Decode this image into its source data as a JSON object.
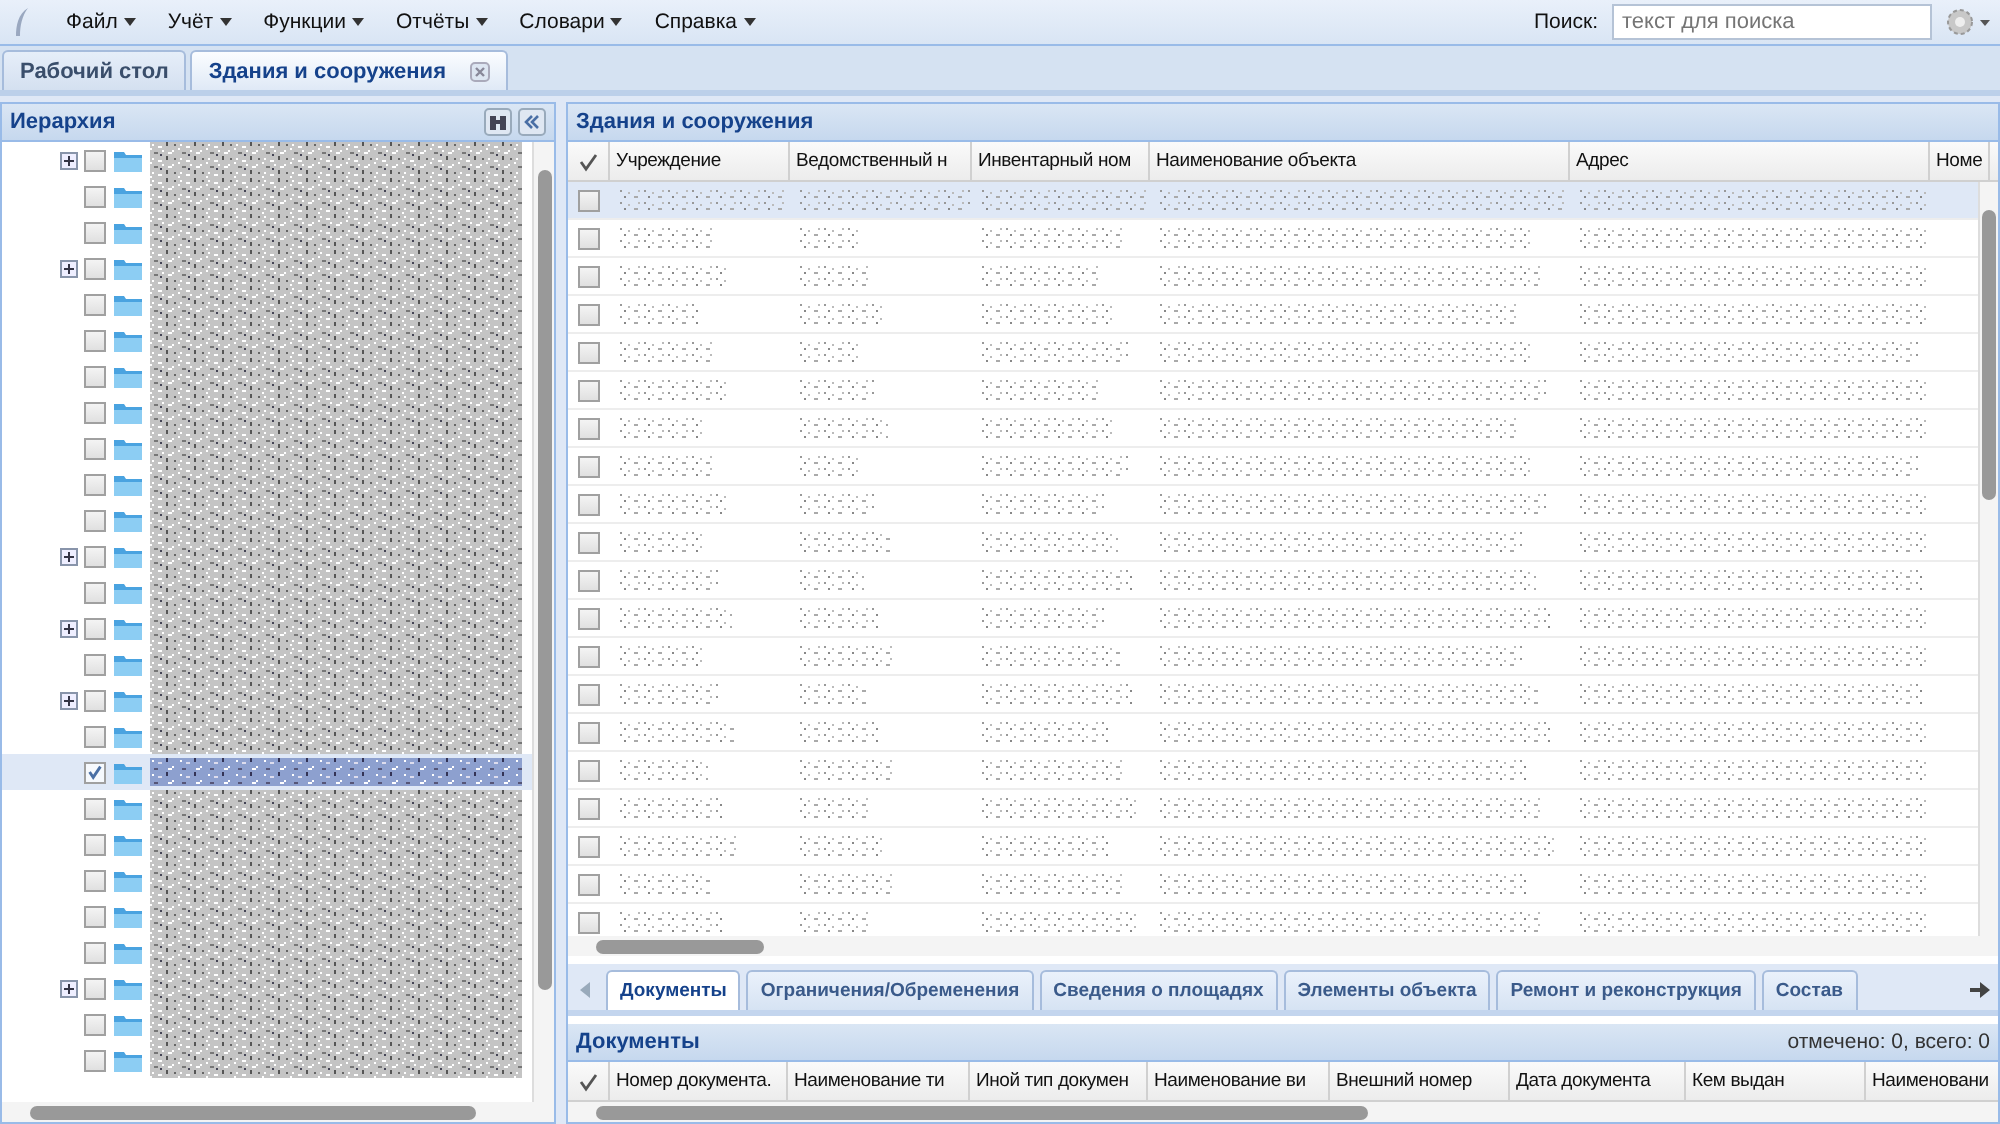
{
  "menu": [
    {
      "label": "Файл"
    },
    {
      "label": "Учёт"
    },
    {
      "label": "Функции"
    },
    {
      "label": "Отчёты"
    },
    {
      "label": "Словари"
    },
    {
      "label": "Справка"
    }
  ],
  "search": {
    "label": "Поиск:",
    "placeholder": "текст для поиска"
  },
  "tabs": [
    {
      "label": "Рабочий стол",
      "selected": false,
      "closable": false
    },
    {
      "label": "Здания и сооружения",
      "selected": true,
      "closable": true
    }
  ],
  "hierarchy": {
    "title": "Иерархия",
    "nodes": [
      {
        "expandable": true,
        "checked": false,
        "selected": false
      },
      {
        "expandable": false,
        "checked": false,
        "selected": false
      },
      {
        "expandable": false,
        "checked": false,
        "selected": false
      },
      {
        "expandable": true,
        "checked": false,
        "selected": false
      },
      {
        "expandable": false,
        "checked": false,
        "selected": false
      },
      {
        "expandable": false,
        "checked": false,
        "selected": false
      },
      {
        "expandable": false,
        "checked": false,
        "selected": false
      },
      {
        "expandable": false,
        "checked": false,
        "selected": false
      },
      {
        "expandable": false,
        "checked": false,
        "selected": false
      },
      {
        "expandable": false,
        "checked": false,
        "selected": false
      },
      {
        "expandable": false,
        "checked": false,
        "selected": false
      },
      {
        "expandable": true,
        "checked": false,
        "selected": false
      },
      {
        "expandable": false,
        "checked": false,
        "selected": false
      },
      {
        "expandable": true,
        "checked": false,
        "selected": false
      },
      {
        "expandable": false,
        "checked": false,
        "selected": false
      },
      {
        "expandable": true,
        "checked": false,
        "selected": false
      },
      {
        "expandable": false,
        "checked": false,
        "selected": false
      },
      {
        "expandable": false,
        "checked": true,
        "selected": true
      },
      {
        "expandable": false,
        "checked": false,
        "selected": false
      },
      {
        "expandable": false,
        "checked": false,
        "selected": false
      },
      {
        "expandable": false,
        "checked": false,
        "selected": false
      },
      {
        "expandable": false,
        "checked": false,
        "selected": false
      },
      {
        "expandable": false,
        "checked": false,
        "selected": false
      },
      {
        "expandable": true,
        "checked": false,
        "selected": false
      },
      {
        "expandable": false,
        "checked": false,
        "selected": false
      },
      {
        "expandable": false,
        "checked": false,
        "selected": false
      }
    ]
  },
  "grid": {
    "title": "Здания и сооружения",
    "columns": [
      {
        "label": "Учреждение"
      },
      {
        "label": "Ведомственный н"
      },
      {
        "label": "Инвентарный ном"
      },
      {
        "label": "Наименование объекта"
      },
      {
        "label": "Адрес"
      },
      {
        "label": "Номе"
      }
    ],
    "rows": [
      {
        "checked": false,
        "selected": true
      },
      {
        "checked": false,
        "selected": false
      },
      {
        "checked": false,
        "selected": false
      },
      {
        "checked": false,
        "selected": false
      },
      {
        "checked": false,
        "selected": false
      },
      {
        "checked": false,
        "selected": false
      },
      {
        "checked": false,
        "selected": false
      },
      {
        "checked": false,
        "selected": false
      },
      {
        "checked": false,
        "selected": false
      },
      {
        "checked": false,
        "selected": false
      },
      {
        "checked": false,
        "selected": false
      },
      {
        "checked": false,
        "selected": false
      },
      {
        "checked": false,
        "selected": false
      },
      {
        "checked": false,
        "selected": false
      },
      {
        "checked": false,
        "selected": false
      },
      {
        "checked": false,
        "selected": false
      },
      {
        "checked": false,
        "selected": false
      },
      {
        "checked": false,
        "selected": false
      },
      {
        "checked": false,
        "selected": false
      },
      {
        "checked": false,
        "selected": false
      }
    ]
  },
  "detail_tabs": [
    {
      "label": "Документы",
      "selected": true
    },
    {
      "label": "Ограничения/Обременения",
      "selected": false
    },
    {
      "label": "Сведения о площадях",
      "selected": false
    },
    {
      "label": "Элементы объекта",
      "selected": false
    },
    {
      "label": "Ремонт и реконструкция",
      "selected": false
    },
    {
      "label": "Состав",
      "selected": false
    }
  ],
  "documents": {
    "title": "Документы",
    "summary": "отмечено: 0, всего: 0",
    "columns": [
      {
        "label": "Номер документа."
      },
      {
        "label": "Наименование ти"
      },
      {
        "label": "Иной тип докумен"
      },
      {
        "label": "Наименование ви"
      },
      {
        "label": "Внешний номер"
      },
      {
        "label": "Дата документа"
      },
      {
        "label": "Кем выдан"
      },
      {
        "label": "Наименовани"
      }
    ]
  }
}
